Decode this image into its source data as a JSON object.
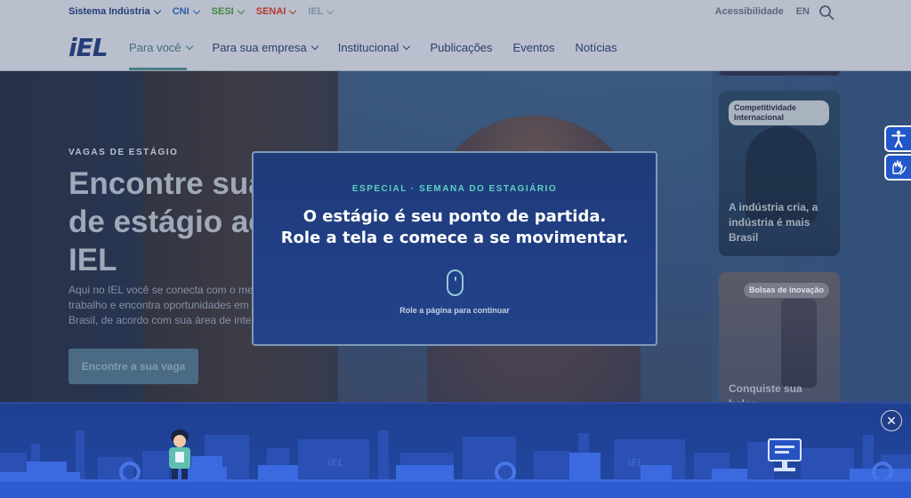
{
  "topbar": {
    "links": [
      {
        "label": "Sistema Indústria",
        "color": "#263d7a"
      },
      {
        "label": "CNI",
        "color": "#2f5fa8"
      },
      {
        "label": "SESI",
        "color": "#3f8a3f"
      },
      {
        "label": "SENAI",
        "color": "#b23a2f"
      },
      {
        "label": "IEL",
        "color": "#7a8fa0"
      }
    ],
    "accessibility_label": "Acessibilidade",
    "language_label": "EN"
  },
  "header": {
    "logo_text": "iEL",
    "nav": [
      {
        "label": "Para você"
      },
      {
        "label": "Para sua empresa"
      },
      {
        "label": "Institucional"
      },
      {
        "label": "Publicações"
      },
      {
        "label": "Eventos"
      },
      {
        "label": "Notícias"
      }
    ]
  },
  "hero": {
    "eyebrow": "VAGAS DE ESTÁGIO",
    "title": "Encontre sua de estágio ac IEL",
    "description": "Aqui no IEL você se conecta com o me trabalho e encontra oportunidades em Brasil, de acordo com sua área de inte",
    "cta_label": "Encontre a sua vaga"
  },
  "cards": [
    {
      "badge": "Competitividade Internacional",
      "text": "A indústria cria, a indústria é mais Brasil"
    },
    {
      "badge": "Bolsas de inovação",
      "text": "Conquiste sua bolsa"
    }
  ],
  "modal": {
    "eyebrow": "ESPECIAL · SEMANA DO ESTAGIÁRIO",
    "title_line1": "O estágio é seu ponto de partida.",
    "title_line2": "Role a tela e comece a se movimentar.",
    "hint": "Role a página para continuar"
  },
  "banner": {
    "close_label": "✕",
    "skyline_logo_text": "iEL"
  },
  "colors": {
    "accent_teal": "#5ed0c3",
    "brand_navy": "#263d7a",
    "widget_blue": "#2157c9"
  }
}
